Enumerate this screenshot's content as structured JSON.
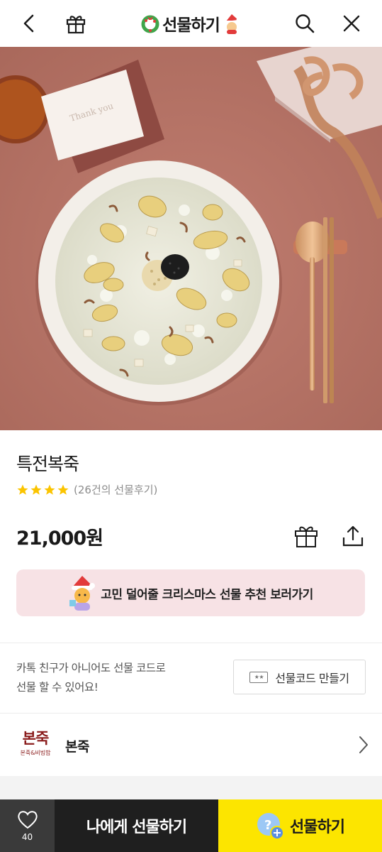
{
  "header": {
    "title": "선물하기",
    "back_icon": "chevron-left-icon",
    "gift_icon": "gift-icon",
    "search_icon": "search-icon",
    "close_icon": "close-icon"
  },
  "product": {
    "name": "특전복죽",
    "rating_stars": 4,
    "review_text": "(26건의 선물후기)",
    "price": "21,000원"
  },
  "banner": {
    "text": "고민 덜어줄 크리스마스 선물 추천 보러가기"
  },
  "gift_code": {
    "line1": "카톡 친구가 아니어도 선물 코드로",
    "line2": "선물 할 수 있어요!",
    "button_label": "선물코드 만들기",
    "ticket_text": "★★"
  },
  "brand": {
    "name": "본죽",
    "logo_text": "본죽",
    "logo_subtext": "본죽&비빔밥"
  },
  "bottom_bar": {
    "like_count": "40",
    "self_gift_label": "나에게 선물하기",
    "gift_label": "선물하기"
  },
  "colors": {
    "accent_yellow": "#fce500",
    "dark_button": "#1f1f1f",
    "banner_bg": "#f7e2e5",
    "star": "#fbc400"
  }
}
